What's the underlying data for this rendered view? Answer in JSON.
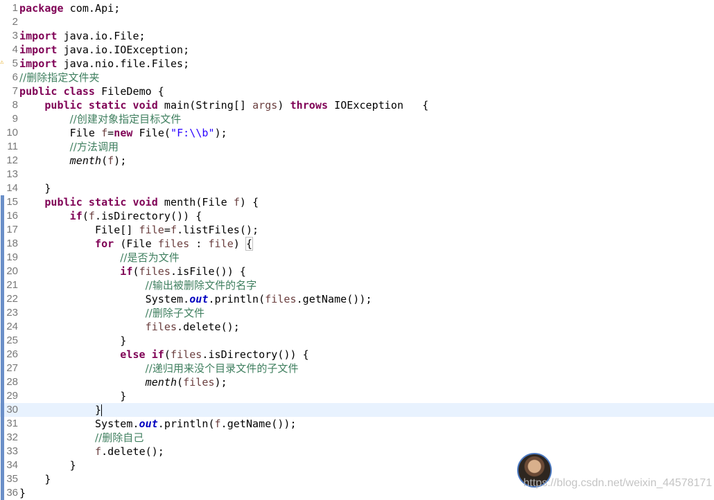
{
  "editor": {
    "current_line": 30,
    "lines": [
      {
        "n": "1",
        "tokens": [
          {
            "t": "kw",
            "v": "package"
          },
          {
            "t": "p",
            "v": " com.Api;"
          }
        ]
      },
      {
        "n": "2",
        "tokens": []
      },
      {
        "n": "3",
        "tokens": [
          {
            "t": "kw",
            "v": "import"
          },
          {
            "t": "p",
            "v": " java.io.File;"
          }
        ]
      },
      {
        "n": "4",
        "tokens": [
          {
            "t": "kw",
            "v": "import"
          },
          {
            "t": "p",
            "v": " java.io.IOException;"
          }
        ]
      },
      {
        "n": "5",
        "tokens": [
          {
            "t": "kw",
            "v": "import"
          },
          {
            "t": "p",
            "v": " java.nio.file.Files;"
          }
        ]
      },
      {
        "n": "6",
        "tokens": [
          {
            "t": "cm",
            "v": "//删除指定文件夹"
          }
        ]
      },
      {
        "n": "7",
        "tokens": [
          {
            "t": "kw",
            "v": "public"
          },
          {
            "t": "p",
            "v": " "
          },
          {
            "t": "kw",
            "v": "class"
          },
          {
            "t": "p",
            "v": " FileDemo {"
          }
        ]
      },
      {
        "n": "8",
        "tokens": [
          {
            "t": "p",
            "v": "    "
          },
          {
            "t": "kw",
            "v": "public"
          },
          {
            "t": "p",
            "v": " "
          },
          {
            "t": "kw",
            "v": "static"
          },
          {
            "t": "p",
            "v": " "
          },
          {
            "t": "kw",
            "v": "void"
          },
          {
            "t": "p",
            "v": " main(String[] "
          },
          {
            "t": "var",
            "v": "args"
          },
          {
            "t": "p",
            "v": ") "
          },
          {
            "t": "kw",
            "v": "throws"
          },
          {
            "t": "p",
            "v": " IOException   {"
          }
        ]
      },
      {
        "n": "9",
        "tokens": [
          {
            "t": "p",
            "v": "        "
          },
          {
            "t": "cm",
            "v": "//创建对象指定目标文件"
          }
        ]
      },
      {
        "n": "10",
        "tokens": [
          {
            "t": "p",
            "v": "        File "
          },
          {
            "t": "var",
            "v": "f"
          },
          {
            "t": "p",
            "v": "="
          },
          {
            "t": "kw",
            "v": "new"
          },
          {
            "t": "p",
            "v": " File("
          },
          {
            "t": "str",
            "v": "\"F:\\\\b\""
          },
          {
            "t": "p",
            "v": ");"
          }
        ]
      },
      {
        "n": "11",
        "tokens": [
          {
            "t": "p",
            "v": "        "
          },
          {
            "t": "cm",
            "v": "//方法调用"
          }
        ]
      },
      {
        "n": "12",
        "tokens": [
          {
            "t": "p",
            "v": "        "
          },
          {
            "t": "it",
            "v": "menth"
          },
          {
            "t": "p",
            "v": "("
          },
          {
            "t": "var",
            "v": "f"
          },
          {
            "t": "p",
            "v": ");"
          }
        ]
      },
      {
        "n": "13",
        "tokens": []
      },
      {
        "n": "14",
        "tokens": [
          {
            "t": "p",
            "v": "    }"
          }
        ]
      },
      {
        "n": "15",
        "tokens": [
          {
            "t": "p",
            "v": "    "
          },
          {
            "t": "kw",
            "v": "public"
          },
          {
            "t": "p",
            "v": " "
          },
          {
            "t": "kw",
            "v": "static"
          },
          {
            "t": "p",
            "v": " "
          },
          {
            "t": "kw",
            "v": "void"
          },
          {
            "t": "p",
            "v": " menth(File "
          },
          {
            "t": "var",
            "v": "f"
          },
          {
            "t": "p",
            "v": ") {"
          }
        ]
      },
      {
        "n": "16",
        "tokens": [
          {
            "t": "p",
            "v": "        "
          },
          {
            "t": "kw",
            "v": "if"
          },
          {
            "t": "p",
            "v": "("
          },
          {
            "t": "var",
            "v": "f"
          },
          {
            "t": "p",
            "v": ".isDirectory()) {"
          }
        ]
      },
      {
        "n": "17",
        "tokens": [
          {
            "t": "p",
            "v": "            File[] "
          },
          {
            "t": "var",
            "v": "file"
          },
          {
            "t": "p",
            "v": "="
          },
          {
            "t": "var",
            "v": "f"
          },
          {
            "t": "p",
            "v": ".listFiles();"
          }
        ]
      },
      {
        "n": "18",
        "tokens": [
          {
            "t": "p",
            "v": "            "
          },
          {
            "t": "kw",
            "v": "for"
          },
          {
            "t": "p",
            "v": " (File "
          },
          {
            "t": "var",
            "v": "files"
          },
          {
            "t": "p",
            "v": " : "
          },
          {
            "t": "var",
            "v": "file"
          },
          {
            "t": "p",
            "v": ") "
          },
          {
            "t": "box",
            "v": "{"
          }
        ]
      },
      {
        "n": "19",
        "tokens": [
          {
            "t": "p",
            "v": "                "
          },
          {
            "t": "cm",
            "v": "//是否为文件"
          }
        ]
      },
      {
        "n": "20",
        "tokens": [
          {
            "t": "p",
            "v": "                "
          },
          {
            "t": "kw",
            "v": "if"
          },
          {
            "t": "p",
            "v": "("
          },
          {
            "t": "var",
            "v": "files"
          },
          {
            "t": "p",
            "v": ".isFile()) {"
          }
        ]
      },
      {
        "n": "21",
        "tokens": [
          {
            "t": "p",
            "v": "                    "
          },
          {
            "t": "cm",
            "v": "//输出被删除文件的名字"
          }
        ]
      },
      {
        "n": "22",
        "tokens": [
          {
            "t": "p",
            "v": "                    System."
          },
          {
            "t": "fld",
            "v": "out"
          },
          {
            "t": "p",
            "v": ".println("
          },
          {
            "t": "var",
            "v": "files"
          },
          {
            "t": "p",
            "v": ".getName());"
          }
        ]
      },
      {
        "n": "23",
        "tokens": [
          {
            "t": "p",
            "v": "                    "
          },
          {
            "t": "cm",
            "v": "//删除子文件"
          }
        ]
      },
      {
        "n": "24",
        "tokens": [
          {
            "t": "p",
            "v": "                    "
          },
          {
            "t": "var",
            "v": "files"
          },
          {
            "t": "p",
            "v": ".delete();"
          }
        ]
      },
      {
        "n": "25",
        "tokens": [
          {
            "t": "p",
            "v": "                }"
          }
        ]
      },
      {
        "n": "26",
        "tokens": [
          {
            "t": "p",
            "v": "                "
          },
          {
            "t": "kw",
            "v": "else"
          },
          {
            "t": "p",
            "v": " "
          },
          {
            "t": "kw",
            "v": "if"
          },
          {
            "t": "p",
            "v": "("
          },
          {
            "t": "var",
            "v": "files"
          },
          {
            "t": "p",
            "v": ".isDirectory()) {"
          }
        ]
      },
      {
        "n": "27",
        "tokens": [
          {
            "t": "p",
            "v": "                    "
          },
          {
            "t": "cm",
            "v": "//递归用来没个目录文件的子文件"
          }
        ]
      },
      {
        "n": "28",
        "tokens": [
          {
            "t": "p",
            "v": "                    "
          },
          {
            "t": "it",
            "v": "menth"
          },
          {
            "t": "p",
            "v": "("
          },
          {
            "t": "var",
            "v": "files"
          },
          {
            "t": "p",
            "v": ");"
          }
        ]
      },
      {
        "n": "29",
        "tokens": [
          {
            "t": "p",
            "v": "                }"
          }
        ]
      },
      {
        "n": "30",
        "tokens": [
          {
            "t": "p",
            "v": "            }"
          },
          {
            "t": "caret",
            "v": ""
          }
        ]
      },
      {
        "n": "31",
        "tokens": [
          {
            "t": "p",
            "v": "            System."
          },
          {
            "t": "fld",
            "v": "out"
          },
          {
            "t": "p",
            "v": ".println("
          },
          {
            "t": "var",
            "v": "f"
          },
          {
            "t": "p",
            "v": ".getName());"
          }
        ]
      },
      {
        "n": "32",
        "tokens": [
          {
            "t": "p",
            "v": "            "
          },
          {
            "t": "cm",
            "v": "//删除自己"
          }
        ]
      },
      {
        "n": "33",
        "tokens": [
          {
            "t": "p",
            "v": "            "
          },
          {
            "t": "var",
            "v": "f"
          },
          {
            "t": "p",
            "v": ".delete();"
          }
        ]
      },
      {
        "n": "34",
        "tokens": [
          {
            "t": "p",
            "v": "        }"
          }
        ]
      },
      {
        "n": "35",
        "tokens": [
          {
            "t": "p",
            "v": "    }"
          }
        ]
      },
      {
        "n": "36",
        "tokens": [
          {
            "t": "p",
            "v": "}"
          }
        ]
      }
    ],
    "override_marks": [
      "15",
      "16",
      "17",
      "18",
      "19",
      "20",
      "21",
      "22",
      "23",
      "24",
      "25",
      "26",
      "27",
      "28",
      "29",
      "30",
      "31",
      "32",
      "33",
      "34",
      "35",
      "36"
    ]
  },
  "watermark": {
    "text": "https://blog.csdn.net/weixin_44578171"
  }
}
